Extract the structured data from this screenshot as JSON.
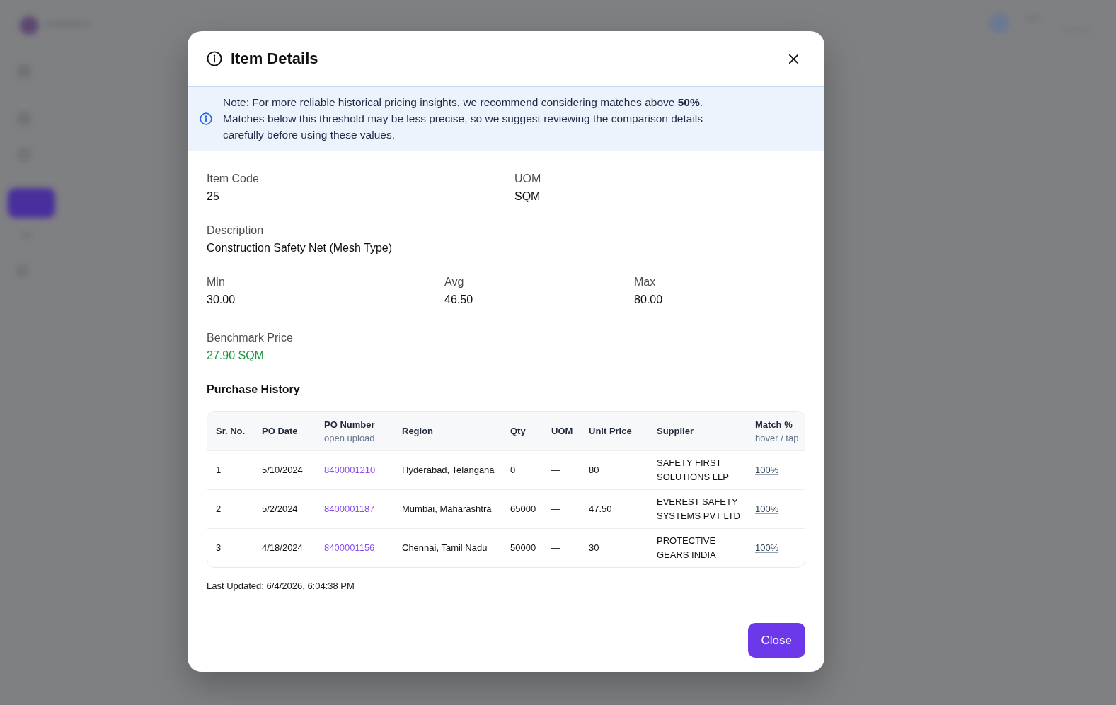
{
  "dialog": {
    "title": "Item Details",
    "note": "Note: For more reliable historical pricing insights, we recommend considering matches above **50%**. Matches below this threshold may be less precise, so we suggest reviewing the comparison details carefully before using these values.",
    "field_rows": [
      [
        {
          "label": "Item Code",
          "value": "25",
          "kind": "plain"
        },
        {
          "label": "UOM",
          "value": "SQM",
          "kind": "plain"
        }
      ],
      [
        {
          "label": "Description",
          "value": "Construction Safety Net (Mesh Type)",
          "kind": "plain"
        }
      ],
      [
        {
          "label": "Min",
          "value": "30.00",
          "kind": "plain"
        },
        {
          "label": "Avg",
          "value": "46.50",
          "kind": "plain"
        },
        {
          "label": "Max",
          "value": "80.00",
          "kind": "plain"
        }
      ],
      [
        {
          "label": "Benchmark Price",
          "value": "27.90 SQM",
          "kind": "benchmark"
        }
      ]
    ],
    "purchase_history": {
      "title": "Purchase History",
      "columns": [
        {
          "label": "Sr. No."
        },
        {
          "label": "PO Date"
        },
        {
          "label": "PO Number",
          "sublabel": "open upload"
        },
        {
          "label": "Region"
        },
        {
          "label": "Qty"
        },
        {
          "label": "UOM"
        },
        {
          "label": "Unit Price"
        },
        {
          "label": "Supplier"
        },
        {
          "label": "Match %",
          "sublabel": "hover / tap"
        }
      ],
      "rows": [
        {
          "sr_no": "1",
          "po_date": "5/10/2024",
          "po_number": "8400001210",
          "region": "Hyderabad, Telangana",
          "qty": "0",
          "uom": "—",
          "unit_price": "80",
          "supplier": "SAFETY FIRST SOLUTIONS LLP",
          "match": "100%"
        },
        {
          "sr_no": "2",
          "po_date": "5/2/2024",
          "po_number": "8400001187",
          "region": "Mumbai, Maharashtra",
          "qty": "65000",
          "uom": "—",
          "unit_price": "47.50",
          "supplier": "EVEREST SAFETY SYSTEMS PVT LTD",
          "match": "100%"
        },
        {
          "sr_no": "3",
          "po_date": "4/18/2024",
          "po_number": "8400001156",
          "region": "Chennai, Tamil Nadu",
          "qty": "50000",
          "uom": "—",
          "unit_price": "30",
          "supplier": "PROTECTIVE GEARS INDIA",
          "match": "100%"
        }
      ]
    },
    "last_updated": "Last Updated: 6/4/2026, 6:04:38 PM",
    "footer_button": "Close"
  }
}
